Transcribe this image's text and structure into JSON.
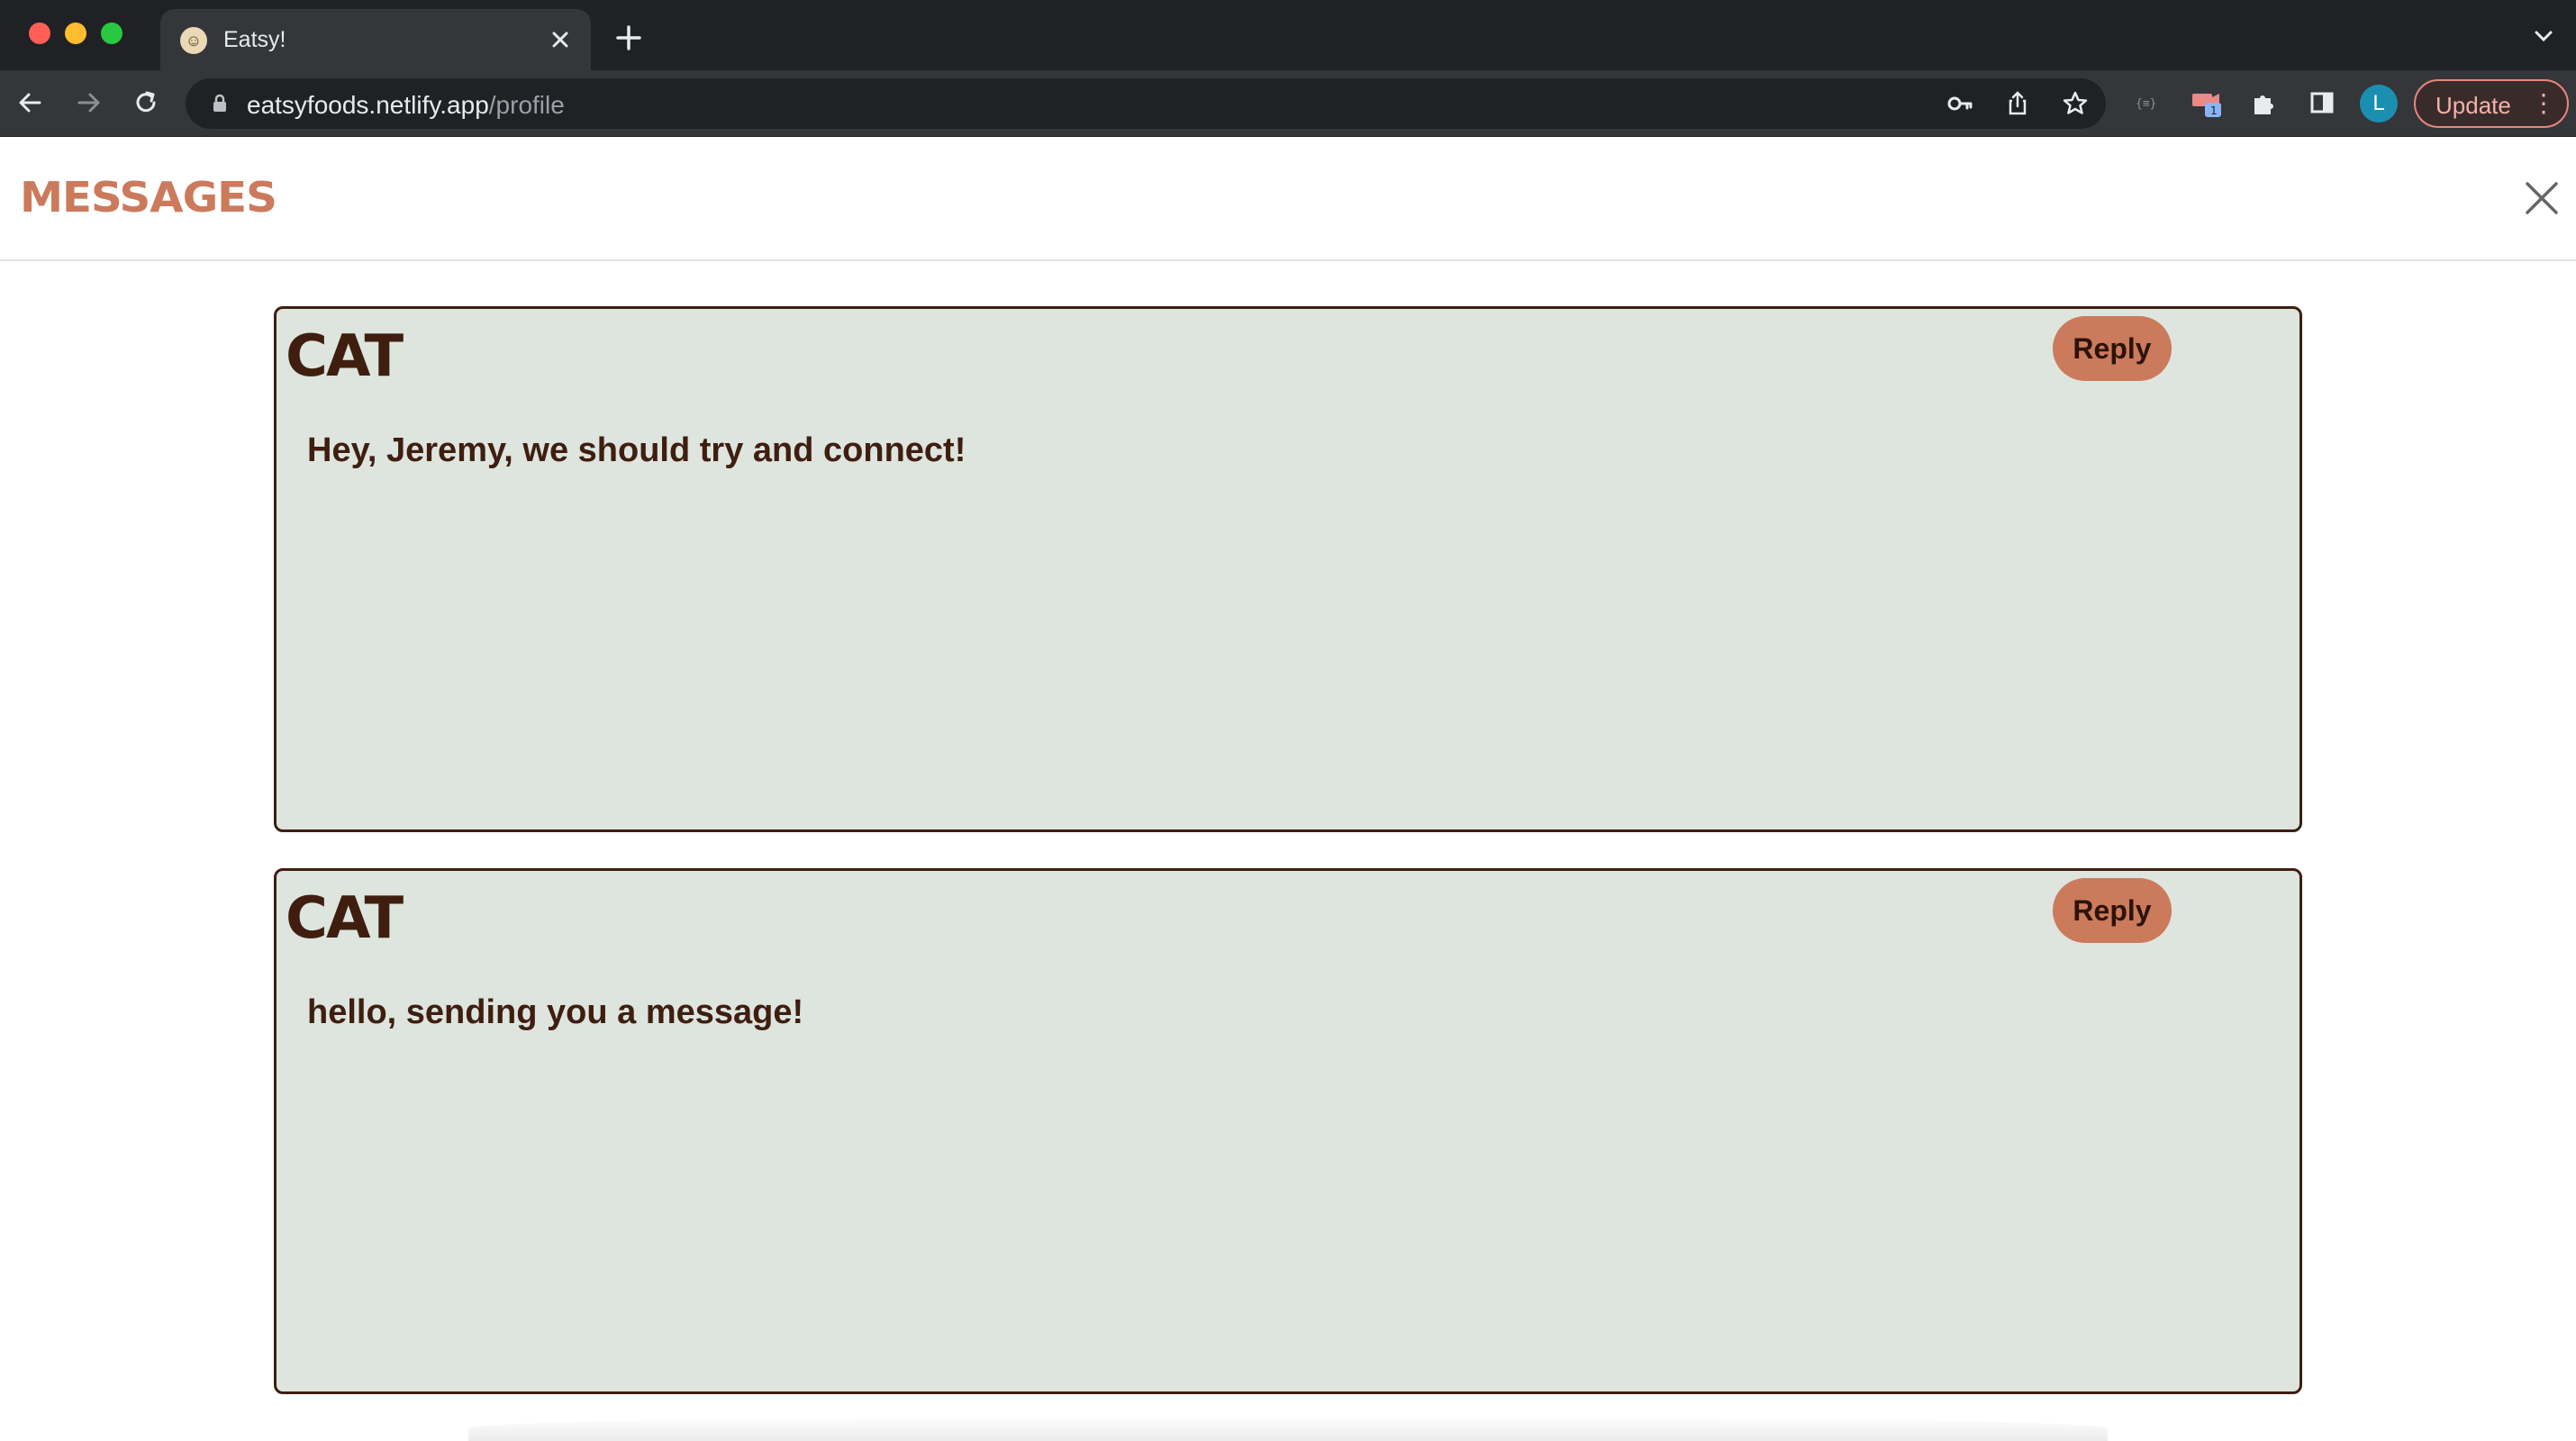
{
  "browser": {
    "tab": {
      "title": "Eatsy!",
      "close_icon": "close-icon",
      "favicon": "chef-favicon"
    },
    "new_tab_label": "+",
    "address": {
      "host": "eatsyfoods.netlify.app",
      "path": "/profile"
    },
    "profile_initial": "L",
    "update_label": "Update",
    "extension_badge": "1"
  },
  "page": {
    "title": "MESSAGES",
    "accent_color": "#cc7a5c",
    "card_color": "#dde5de",
    "text_color": "#3f1e10"
  },
  "messages": [
    {
      "sender": "CAT",
      "body": "Hey, Jeremy, we should try and connect!",
      "reply_label": "Reply"
    },
    {
      "sender": "CAT",
      "body": "hello, sending you a message!",
      "reply_label": "Reply"
    }
  ]
}
